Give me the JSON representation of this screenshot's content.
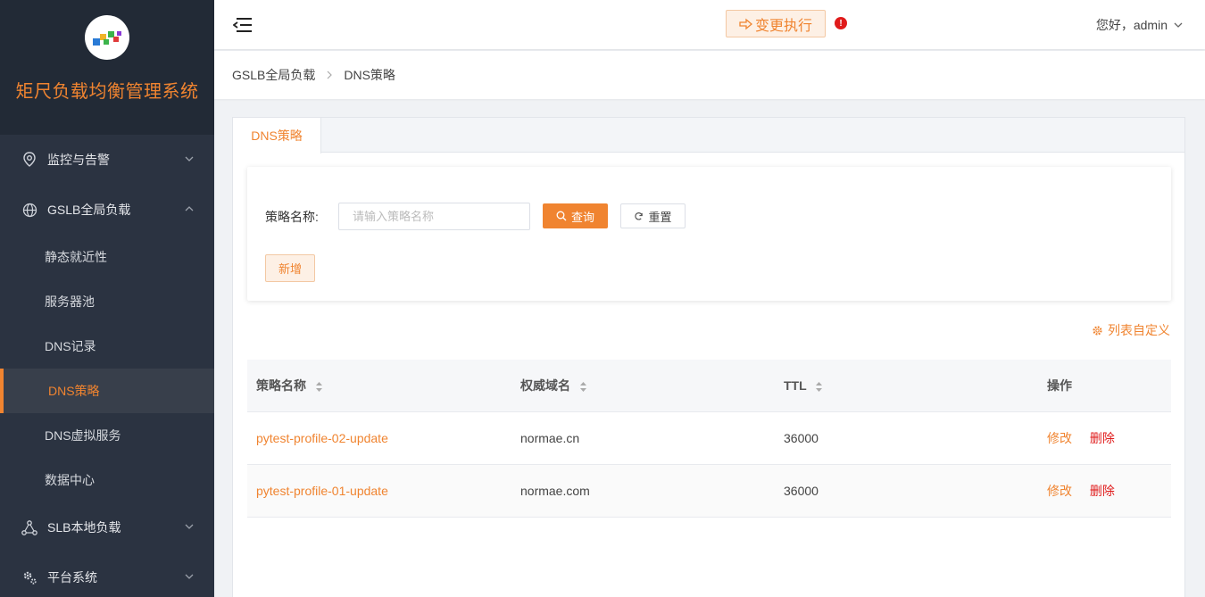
{
  "app": {
    "title": "矩尺负载均衡管理系统"
  },
  "sidebar": {
    "groups": [
      {
        "label": "监控与告警",
        "icon": "location-pin-icon",
        "expanded": false
      },
      {
        "label": "GSLB全局负载",
        "icon": "globe-icon",
        "expanded": true,
        "items": [
          {
            "label": "静态就近性"
          },
          {
            "label": "服务器池"
          },
          {
            "label": "DNS记录"
          },
          {
            "label": "DNS策略",
            "active": true
          },
          {
            "label": "DNS虚拟服务"
          },
          {
            "label": "数据中心"
          }
        ]
      },
      {
        "label": "SLB本地负载",
        "icon": "network-nodes-icon",
        "expanded": false
      },
      {
        "label": "平台系统",
        "icon": "gears-icon",
        "expanded": false
      }
    ]
  },
  "header": {
    "exec_label": "变更执行",
    "alert_mark": "!",
    "user_label": "您好，admin"
  },
  "breadcrumb": {
    "items": [
      "GSLB全局负载",
      "DNS策略"
    ]
  },
  "tabs": [
    {
      "label": "DNS策略",
      "active": true
    }
  ],
  "search": {
    "label": "策略名称:",
    "placeholder": "请输入策略名称",
    "value": "",
    "query_label": "查询",
    "reset_label": "重置",
    "add_label": "新增"
  },
  "customize_label": "列表自定义",
  "table": {
    "headers": [
      "策略名称",
      "权威域名",
      "TTL",
      "操作"
    ],
    "rows": [
      {
        "name": "pytest-profile-02-update",
        "domain": "normae.cn",
        "ttl": "36000",
        "edit": "修改",
        "delete": "删除"
      },
      {
        "name": "pytest-profile-01-update",
        "domain": "normae.com",
        "ttl": "36000",
        "edit": "修改",
        "delete": "删除"
      }
    ]
  },
  "colors": {
    "accent": "#f08430",
    "sidebar_bg": "#2b3341",
    "danger": "#e01b1b"
  }
}
